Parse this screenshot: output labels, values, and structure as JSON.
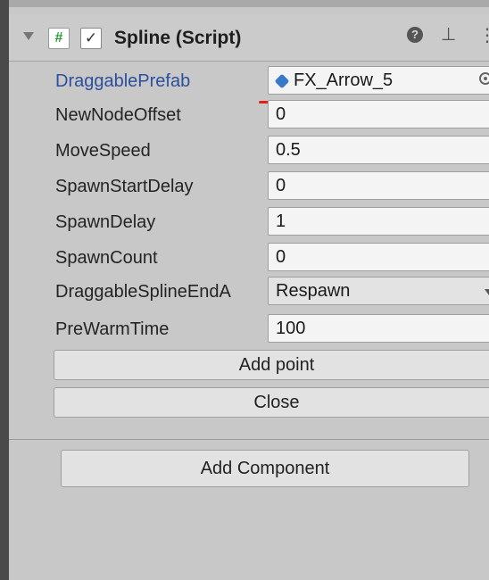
{
  "component": {
    "title": "Spline (Script)",
    "script_icon_glyph": "#",
    "enabled_check_glyph": "✓",
    "help_glyph": "?",
    "settings_glyph": "⊥",
    "kebab_glyph": "⋮"
  },
  "properties": [
    {
      "label": "DraggablePrefab",
      "value": "FX_Arrow_5",
      "kind": "object",
      "label_color": "#2c4f9e"
    },
    {
      "label": "NewNodeOffset",
      "value": "0",
      "kind": "text"
    },
    {
      "label": "MoveSpeed",
      "value": "0.5",
      "kind": "text"
    },
    {
      "label": "SpawnStartDelay",
      "value": "0",
      "kind": "text"
    },
    {
      "label": "SpawnDelay",
      "value": "1",
      "kind": "text"
    },
    {
      "label": "SpawnCount",
      "value": "0",
      "kind": "text"
    },
    {
      "label": "DraggableSplineEndA",
      "value": "Respawn",
      "kind": "dropdown"
    },
    {
      "label": "PreWarmTime",
      "value": "100",
      "kind": "text"
    }
  ],
  "buttons": {
    "add_point": "Add point",
    "close": "Close",
    "add_component": "Add Component"
  },
  "colors": {
    "annotation_underline": "#e0201a",
    "prefab_icon": "#3a78c8"
  }
}
